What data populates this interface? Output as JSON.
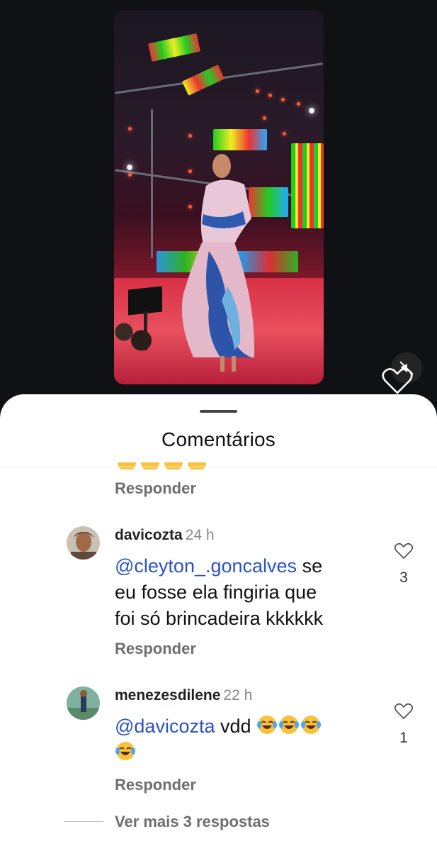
{
  "video": {
    "mute_icon": "speaker-muted-icon",
    "like_overlay_icon": "heart-outline-icon"
  },
  "sheet": {
    "title": "Comentários"
  },
  "prev_comment": {
    "reply_label": "Responder"
  },
  "comments": [
    {
      "username": "davicozta",
      "time": "24 h",
      "mention": "@cleyton_.goncalves",
      "text_line1": " se",
      "text_line2": "eu fosse ela fingiria que",
      "text_line3": "foi só brincadeira kkkkkk",
      "likes": "3",
      "reply_label": "Responder"
    },
    {
      "username": "menezesdilene",
      "time": "22 h",
      "mention": "@davicozta",
      "text_after": " vdd",
      "emojis": [
        "face-with-tears-of-joy",
        "face-with-tears-of-joy",
        "face-with-tears-of-joy",
        "face-with-tears-of-joy"
      ],
      "likes": "1",
      "reply_label": "Responder"
    }
  ],
  "more_replies_label": "Ver mais 3 respostas",
  "colors": {
    "mention": "#2b52c8",
    "muted_text": "#6e6e6e",
    "background": "#0f1115"
  }
}
